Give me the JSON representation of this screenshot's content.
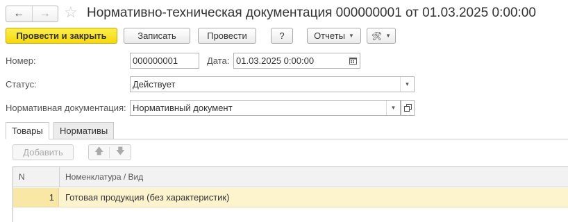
{
  "window": {
    "title": "Нормативно-техническая документация 000000001 от 01.03.2025 0:00:00",
    "back_label": "←",
    "forward_label": "→",
    "favorite_label": "☆"
  },
  "toolbar": {
    "post_and_close_label": "Провести и закрыть",
    "write_label": "Записать",
    "post_label": "Провести",
    "help_label": "?",
    "reports_label": "Отчеты",
    "tools_label": "🛠"
  },
  "form": {
    "number_label": "Номер:",
    "number_value": "000000001",
    "date_label": "Дата:",
    "date_value": "01.03.2025  0:00:00",
    "status_label": "Статус:",
    "status_value": "Действует",
    "normative_doc_label": "Нормативная документация:",
    "normative_doc_value": "Нормативный документ"
  },
  "tabs": [
    {
      "label": "Товары",
      "active": true
    },
    {
      "label": "Нормативы",
      "active": false
    }
  ],
  "table_toolbar": {
    "add_label": "Добавить",
    "move_up_label": "🡅",
    "move_down_label": "🡇"
  },
  "table": {
    "columns": [
      "N",
      "Номенклатура / Вид"
    ],
    "rows": [
      {
        "n": "1",
        "name": "Готовая продукция (без характеристик)"
      }
    ]
  },
  "colors": {
    "primary_button": "#f6d90b",
    "selected_row": "#fdf4cd"
  }
}
